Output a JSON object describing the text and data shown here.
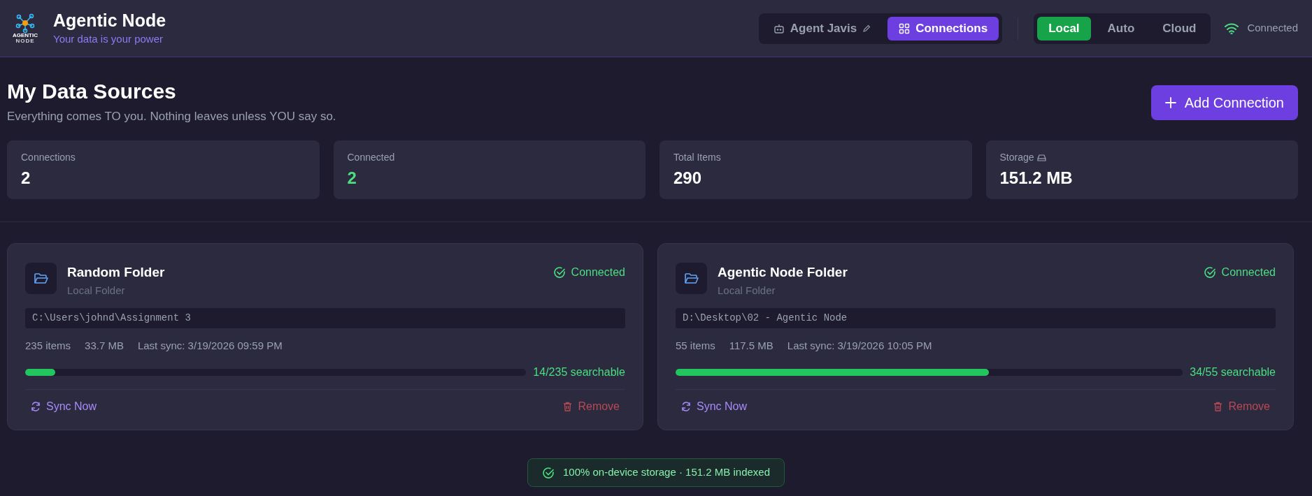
{
  "header": {
    "logo_text": [
      "AGENTIC",
      "NODE"
    ],
    "title": "Agentic Node",
    "tagline": "Your data is your power",
    "view_tabs": [
      {
        "label": "Agent Javis",
        "kind": "agent",
        "selected": false
      },
      {
        "label": "Connections",
        "kind": "grid",
        "selected": true
      }
    ],
    "mode_tabs": [
      {
        "label": "Local",
        "selected": true
      },
      {
        "label": "Auto",
        "selected": false
      },
      {
        "label": "Cloud",
        "selected": false
      }
    ],
    "status": "Connected"
  },
  "page": {
    "title": "My Data Sources",
    "subtitle": "Everything comes TO you. Nothing leaves unless YOU say so.",
    "add_button": "Add Connection"
  },
  "stats": [
    {
      "label": "Connections",
      "value": "2",
      "kind": "plain",
      "color": "#ffffff"
    },
    {
      "label": "Connected",
      "value": "2",
      "kind": "plain",
      "color": "#4ade80"
    },
    {
      "label": "Total Items",
      "value": "290",
      "kind": "plain",
      "color": "#ffffff"
    },
    {
      "label": "Storage",
      "value": "151.2 MB",
      "kind": "storage",
      "color": "#ffffff"
    }
  ],
  "sources": [
    {
      "name": "Random Folder",
      "type": "Local Folder",
      "status": "Connected",
      "path": "C:\\Users\\johnd\\Assignment 3",
      "items": "235 items",
      "size": "33.7 MB",
      "last_sync": "Last sync: 3/19/2026 09:59 PM",
      "level": 0.06,
      "searchable": "14/235 searchable",
      "sync": "Sync Now",
      "remove": "Remove"
    },
    {
      "name": "Agentic Node Folder",
      "type": "Local Folder",
      "status": "Connected",
      "path": "D:\\Desktop\\02 - Agentic Node",
      "items": "55 items",
      "size": "117.5 MB",
      "last_sync": "Last sync: 3/19/2026 10:05 PM",
      "level": 0.618,
      "searchable": "34/55 searchable",
      "sync": "Sync Now",
      "remove": "Remove"
    }
  ],
  "footer_badge": "100% on-device storage · 151.2 MB indexed"
}
